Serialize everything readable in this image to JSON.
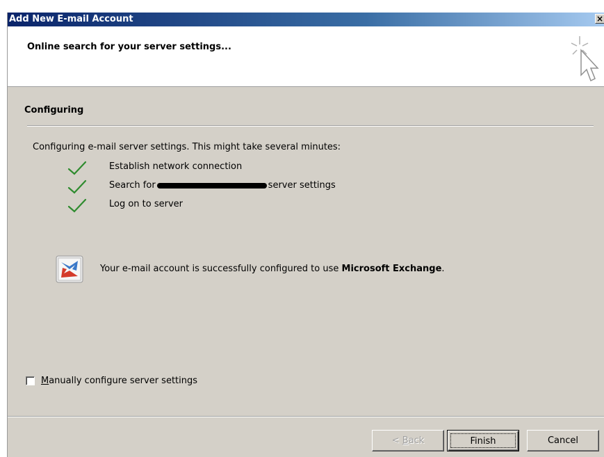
{
  "window": {
    "title": "Add New E-mail Account",
    "close_glyph": "×"
  },
  "header": {
    "title": "Online search for your server settings...",
    "icon": "cursor-sparkle-icon"
  },
  "section": {
    "title": "Configuring"
  },
  "progress": {
    "intro": "Configuring e-mail server settings. This might take several minutes:",
    "steps": [
      {
        "label": "Establish network connection",
        "status": "done"
      },
      {
        "label_before": "Search for",
        "label_after": "server settings",
        "status": "done"
      },
      {
        "label": "Log on to server",
        "status": "done"
      }
    ]
  },
  "result": {
    "text": "Your e-mail account is successfully configured to use ",
    "product": "Microsoft Exchange",
    "suffix": ".",
    "icon": "exchange-icon"
  },
  "manual": {
    "label_mnemonic": "M",
    "label_rest": "anually configure server settings",
    "checked": false
  },
  "buttons": {
    "back_mnemonic": "B",
    "back_prefix": "< ",
    "back_rest": "ack",
    "finish": "Finish",
    "cancel": "Cancel"
  },
  "colors": {
    "check": "#2e8b2e",
    "title_bar": "#0a246a",
    "face": "#d4d0c8"
  }
}
